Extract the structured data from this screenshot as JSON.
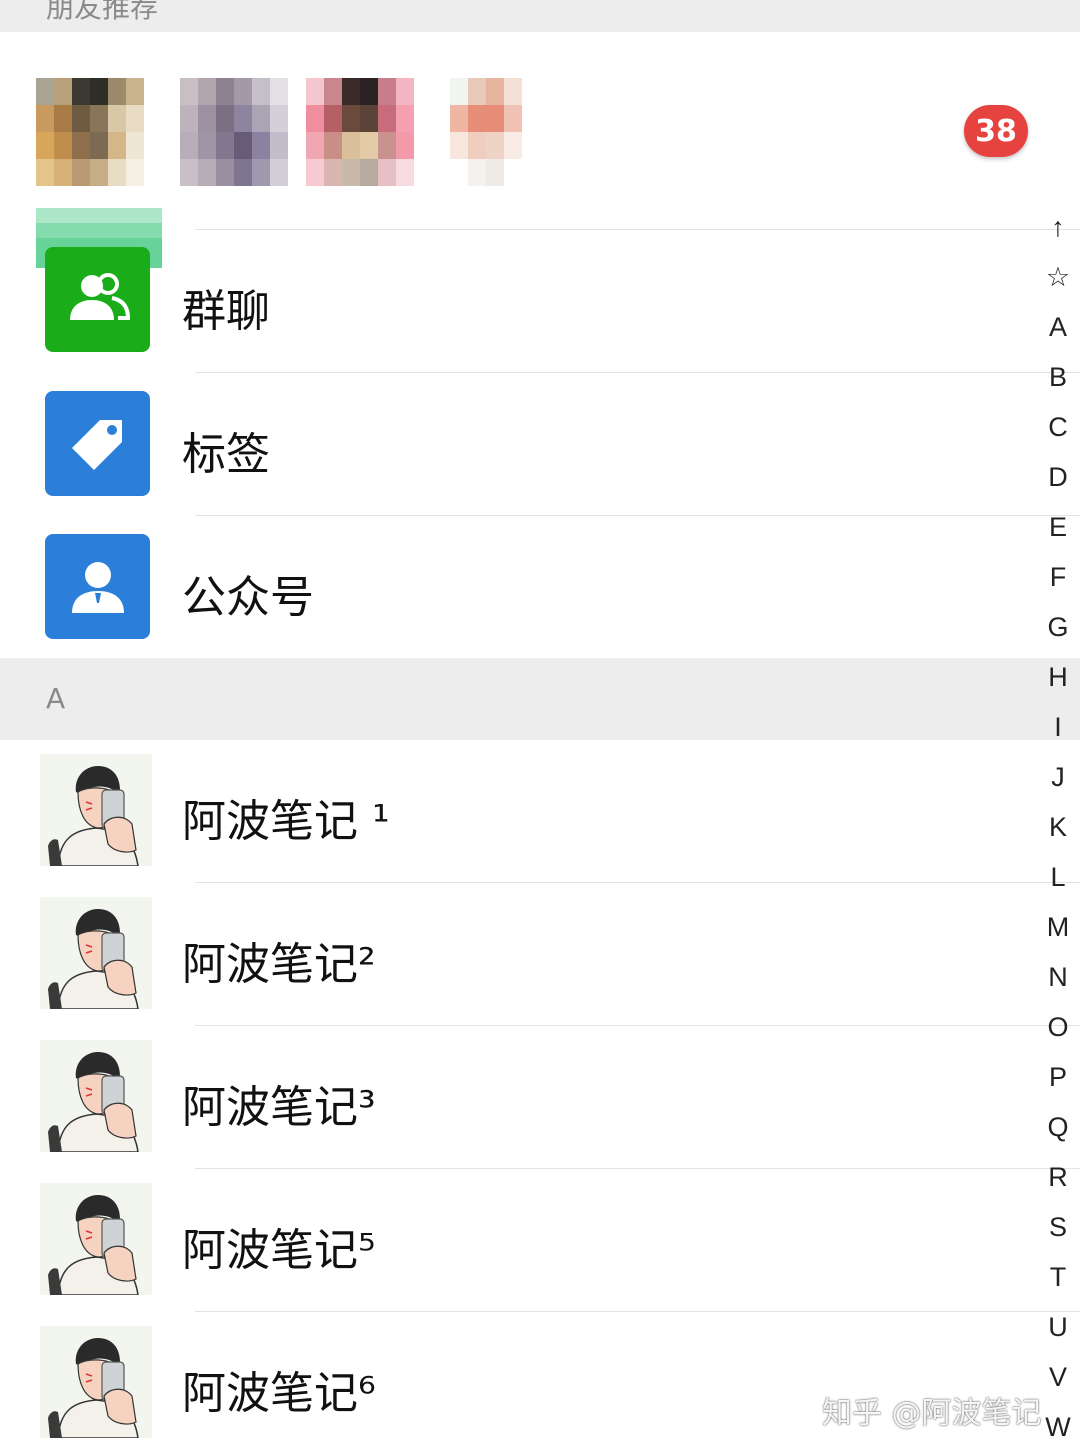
{
  "header": {
    "title": "朋友推荐"
  },
  "recommend": {
    "badge_count": "38",
    "avatars": [
      {
        "colors": [
          "#a9a592",
          "#b8a07a",
          "#3c3a30",
          "#2d2e27",
          "#9c8a6c",
          "#c9b38d",
          "#c89a5d",
          "#a97b47",
          "#6e5b41",
          "#8a7558",
          "#d8c8a8",
          "#e8dcc4",
          "#d7a65b",
          "#c08e4c",
          "#8e6f4b",
          "#7c6a53",
          "#d4b689",
          "#efe6d6",
          "#e3c48b",
          "#d6b075",
          "#b99a72",
          "#c7ad86",
          "#e9dcc5",
          "#f5efe4"
        ]
      },
      {
        "colors": [
          "#c8bfc5",
          "#b2a5ad",
          "#8e8290",
          "#a39aa7",
          "#c5bfc7",
          "#e3e0e4",
          "#bdb3bd",
          "#9d90a0",
          "#7b6f83",
          "#8d84a0",
          "#aaa4b5",
          "#d4d0d8",
          "#b8aeb9",
          "#a095a6",
          "#837790",
          "#675c78",
          "#8a82a0",
          "#c2bdca",
          "#c9c0c7",
          "#b6acb6",
          "#9a8fa1",
          "#7e7590",
          "#9f98ae",
          "#d1ccd6"
        ]
      },
      {
        "colors": [
          "#f4c7cf",
          "#c9868f",
          "#3c2a2a",
          "#2b2224",
          "#c77d8a",
          "#f2b6c2",
          "#f08ea0",
          "#b65f66",
          "#6a4a3d",
          "#5c4338",
          "#c86b7b",
          "#f5a0b1",
          "#f0a6b3",
          "#c98f86",
          "#d9bf9a",
          "#e2cba6",
          "#c9928f",
          "#f29aaa",
          "#f7c9d1",
          "#d9b6b0",
          "#c8b8a8",
          "#b7aba0",
          "#e6c0c4",
          "#f8dbe0"
        ]
      },
      {
        "colors": [
          "#f2f4f2",
          "#e9c9b9",
          "#e7b49e",
          "#f4e1d6",
          "#ffffff",
          "#ffffff",
          "#eeb6a3",
          "#e78f76",
          "#e88e78",
          "#f0c2b3",
          "#ffffff",
          "#ffffff",
          "#f7e7df",
          "#f0cdbf",
          "#efd3c6",
          "#f8eae4",
          "#ffffff",
          "#ffffff",
          "#ffffff",
          "#f4f1ee",
          "#eeeae6",
          "#ffffff",
          "#ffffff",
          "#ffffff"
        ]
      }
    ]
  },
  "entries": [
    {
      "label": "群聊",
      "icon": "group-icon",
      "color": "#1aad19"
    },
    {
      "label": "标签",
      "icon": "tag-icon",
      "color": "#2b7fd9"
    },
    {
      "label": "公众号",
      "icon": "official-account-icon",
      "color": "#2b7fd9"
    }
  ],
  "section": {
    "letter": "A"
  },
  "contacts": [
    {
      "name": "阿波笔记 ¹"
    },
    {
      "name": "阿波笔记²"
    },
    {
      "name": "阿波笔记³"
    },
    {
      "name": "阿波笔记⁵"
    },
    {
      "name": "阿波笔记⁶"
    }
  ],
  "index_bar": [
    "↑",
    "☆",
    "A",
    "B",
    "C",
    "D",
    "E",
    "F",
    "G",
    "H",
    "I",
    "J",
    "K",
    "L",
    "M",
    "N",
    "O",
    "P",
    "Q",
    "R",
    "S",
    "T",
    "U",
    "V",
    "W"
  ],
  "watermark": "知乎 @阿波笔记"
}
